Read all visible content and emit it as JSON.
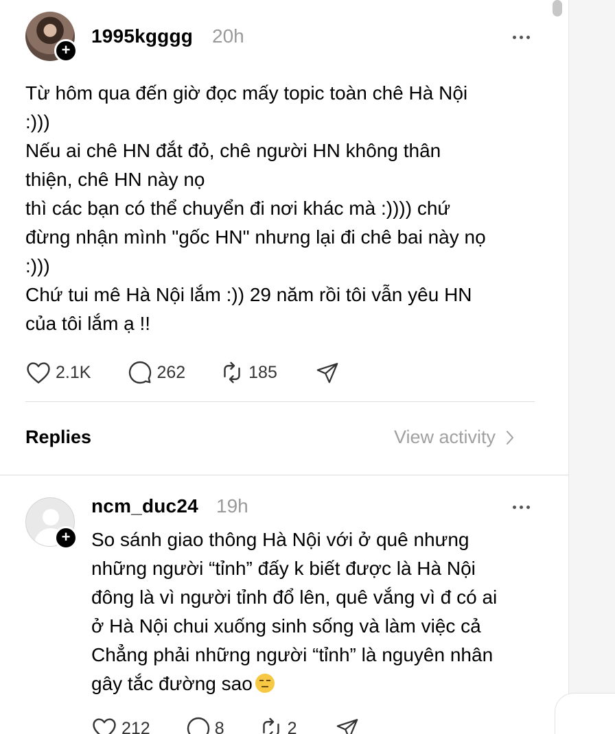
{
  "post": {
    "username": "1995kgggg",
    "time": "20h",
    "lines": [
      "Từ hôm qua đến giờ đọc mấy topic toàn chê Hà Nội",
      ":)))",
      "Nếu ai chê HN đắt đỏ, chê người HN không thân",
      "thiện, chê HN này nọ",
      "thì các bạn có thể chuyển đi nơi khác mà :)))) chứ",
      "đừng nhận mình \"gốc HN\" nhưng lại đi chê bai này nọ",
      ":)))",
      "Chứ tui mê Hà Nội lắm :)) 29 năm rồi tôi vẫn yêu HN",
      "của tôi lắm ạ !!"
    ],
    "likes": "2.1K",
    "comments": "262",
    "reposts": "185"
  },
  "replies_section": {
    "title": "Replies",
    "view_activity": "View activity"
  },
  "reply": {
    "username": "ncm_duc24",
    "time": "19h",
    "lines": [
      "So sánh giao thông Hà Nội với ở quê nhưng",
      "những người “tỉnh” đấy k biết được là Hà Nội",
      "đông là vì người tỉnh đổ lên, quê vắng vì đ có ai",
      "ở Hà Nội chui xuống sinh sống và làm việc cả",
      "Chẳng phải những người “tỉnh” là nguyên nhân",
      "gây tắc đường sao"
    ],
    "emoji": "unamused-face",
    "likes": "212",
    "comments": "8",
    "reposts": "2"
  },
  "icons": [
    "heart-icon",
    "comment-icon",
    "repost-icon",
    "share-icon",
    "more-icon",
    "follow-plus-icon",
    "chevron-right-icon"
  ]
}
